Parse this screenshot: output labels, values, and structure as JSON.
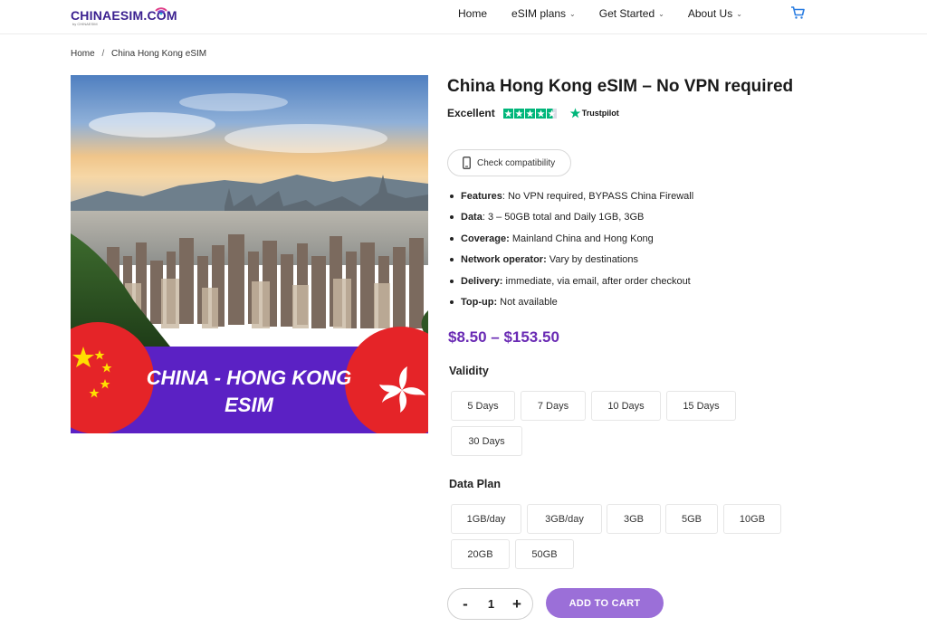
{
  "header": {
    "logo_text": "CHINAESIM.COM",
    "logo_sub": "by CHINAESIM",
    "nav": [
      {
        "label": "Home"
      },
      {
        "label": "eSIM plans"
      },
      {
        "label": "Get Started"
      },
      {
        "label": "About Us"
      }
    ],
    "cart_icon": "cart-icon"
  },
  "breadcrumb": {
    "home": "Home",
    "separator": "/",
    "current": "China Hong Kong eSIM"
  },
  "product": {
    "banner_line1": "CHINA - HONG KONG",
    "banner_line2": "ESIM",
    "title": "China Hong Kong eSIM – No VPN required",
    "rating_word": "Excellent",
    "rating_stars": 4.5,
    "trustpilot": "Trustpilot",
    "compat_label": "Check compatibility",
    "features": [
      {
        "key": "Features",
        "value": ": No VPN required, BYPASS China Firewall"
      },
      {
        "key": "Data",
        "value": ": 3 – 50GB total and Daily 1GB, 3GB"
      },
      {
        "key": "Coverage:",
        "value": " Mainland China and Hong Kong"
      },
      {
        "key": "Network operator:",
        "value": " Vary by destinations"
      },
      {
        "key": "Delivery:",
        "value": " immediate, via email, after order checkout"
      },
      {
        "key": "Top-up:",
        "value": " Not available"
      }
    ],
    "price": "$8.50 – $153.50",
    "validity_label": "Validity",
    "validity_options": [
      "5 Days",
      "7 Days",
      "10 Days",
      "15 Days",
      "30 Days"
    ],
    "dataplan_label": "Data Plan",
    "dataplan_options": [
      "1GB/day",
      "3GB/day",
      "3GB",
      "5GB",
      "10GB",
      "20GB",
      "50GB"
    ],
    "qty_minus": "-",
    "qty_value": "1",
    "qty_plus": "+",
    "add_to_cart": "ADD TO CART"
  },
  "colors": {
    "accent": "#6a2bb4",
    "button": "#9b6fd8",
    "trustpilot_green": "#00b67a",
    "banner_purple": "#5b21c4",
    "flag_red": "#e52428"
  }
}
